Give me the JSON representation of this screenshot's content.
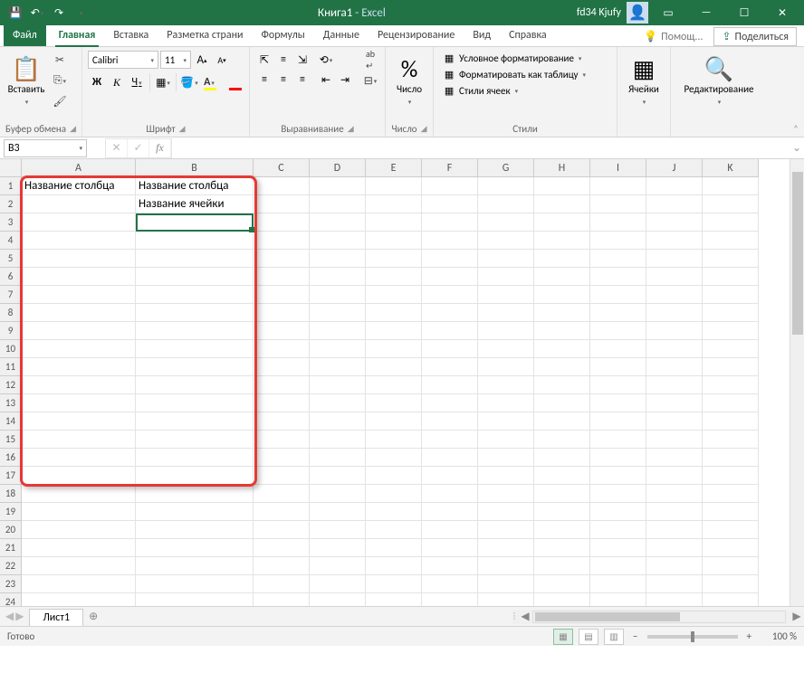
{
  "titlebar": {
    "doc": "Книга1",
    "sep": " - ",
    "app": "Excel",
    "user": "fd34 Kjufy"
  },
  "tabs": {
    "file": "Файл",
    "items": [
      "Главная",
      "Вставка",
      "Разметка страни",
      "Формулы",
      "Данные",
      "Рецензирование",
      "Вид",
      "Справка"
    ],
    "active": 0,
    "tellme": "Помощ...",
    "share": "Поделиться"
  },
  "ribbon": {
    "clipboard": {
      "paste": "Вставить",
      "label": "Буфер обмена"
    },
    "font": {
      "name": "Calibri",
      "size": "11",
      "label": "Шрифт"
    },
    "align": {
      "label": "Выравнивание"
    },
    "number": {
      "btn": "Число",
      "label": "Число",
      "pct": "%"
    },
    "styles": {
      "cond": "Условное форматирование",
      "table": "Форматировать как таблицу",
      "cell": "Стили ячеек",
      "label": "Стили"
    },
    "cells": {
      "btn": "Ячейки"
    },
    "editing": {
      "btn": "Редактирование"
    }
  },
  "namebox": "B3",
  "columns": [
    "A",
    "B",
    "C",
    "D",
    "E",
    "F",
    "G",
    "H",
    "I",
    "J",
    "K"
  ],
  "rowCount": 24,
  "cells": {
    "A1": "Название столбца",
    "B1": "Название столбца",
    "B2": "Название ячейки"
  },
  "sheet": {
    "tab": "Лист1"
  },
  "status": {
    "ready": "Готово",
    "zoom": "100 %"
  }
}
